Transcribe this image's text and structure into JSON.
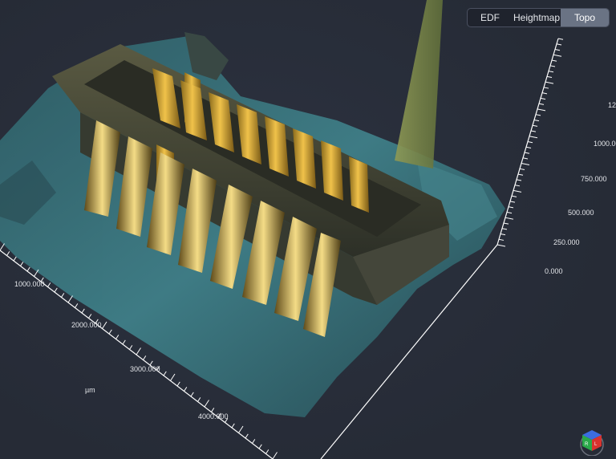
{
  "modes": {
    "items": [
      "EDF",
      "Heightmap",
      "Topo"
    ],
    "active": "Topo"
  },
  "axes": {
    "z_labels": [
      "0.000",
      "250.000",
      "500.000",
      "750.000",
      "1000.000",
      "12"
    ],
    "x_labels": [
      "1000.000",
      "2000.000",
      "3000.000",
      "4000.000"
    ],
    "unit": "µm"
  },
  "colors": {
    "background": "#272c38",
    "axis": "#ffffff",
    "gold": "#d6a734",
    "teal": "#3f7f88"
  },
  "icons": {
    "orientation_gizmo": "view-cube-icon"
  }
}
